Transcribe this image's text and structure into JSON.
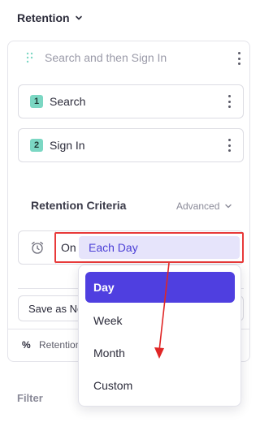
{
  "header": {
    "title": "Retention"
  },
  "funnel": {
    "placeholder": "Search and then Sign In"
  },
  "steps": [
    {
      "index": "1",
      "label": "Search"
    },
    {
      "index": "2",
      "label": "Sign In"
    }
  ],
  "criteria": {
    "title": "Retention Criteria",
    "advanced_label": "Advanced",
    "on_label": "On",
    "selected_value": "Each Day"
  },
  "save_as_label": "Save as New",
  "bottom": {
    "percent_symbol": "%",
    "label": "Retention"
  },
  "filter_label": "Filter",
  "dropdown": {
    "options": [
      "Day",
      "Week",
      "Month",
      "Custom"
    ],
    "selected": "Day"
  },
  "colors": {
    "accent": "#4f3fe0",
    "highlight_border": "#e83a3a",
    "step_badge": "#7bd7c3",
    "selected_bg": "#e6e4fb"
  }
}
